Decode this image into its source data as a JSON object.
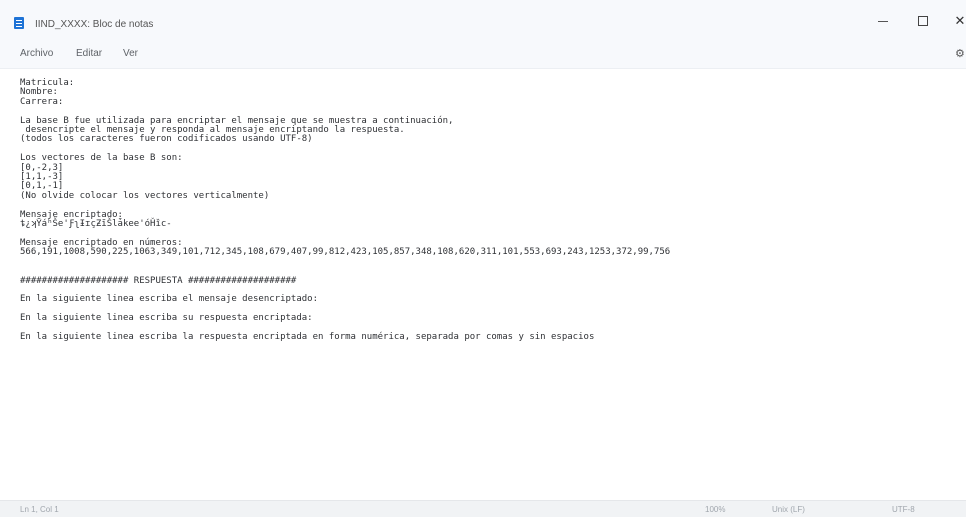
{
  "window": {
    "title": "IIND_XXXX: Bloc de notas",
    "minimize": "—",
    "maximize": "□",
    "close": "✕"
  },
  "menu": {
    "archivo": "Archivo",
    "editar": "Editar",
    "ver": "Ver",
    "settings_icon": "⚙"
  },
  "editor": {
    "text": "Matricula:\nNombre:\nCarrera:\n\nLa base B fue utilizada para encriptar el mensaje que se muestra a continuación,\n desencripte el mensaje y responda al mensaje encriptando la respuesta.\n(todos los caracteres fueron codificados usando UTF-8)\n\nLos vectores de la base B son:\n[0,-2,3]\n[1,1,-3]\n[0,1,-1]\n(No olvide colocar los vectores verticalmente)\n\nMensaje encriptado:\nȶ¿ʞȲáʰŠe'ƑʅƗɪçƵĭŠlǡkee'óȞȉc-\n\nMensaje encriptado en números:\n566,191,1008,590,225,1063,349,101,712,345,108,679,407,99,812,423,105,857,348,108,620,311,101,553,693,243,1253,372,99,756\n\n\n#################### RESPUESTA ####################\n\nEn la siguiente linea escriba el mensaje desencriptado:\n\nEn la siguiente linea escriba su respuesta encriptada:\n\nEn la siguiente linea escriba la respuesta encriptada en forma numérica, separada por comas y sin espacios"
  },
  "status": {
    "position": "Ln 1, Col 1",
    "zoom": "100%",
    "eol": "Unix (LF)",
    "encoding": "UTF-8"
  }
}
